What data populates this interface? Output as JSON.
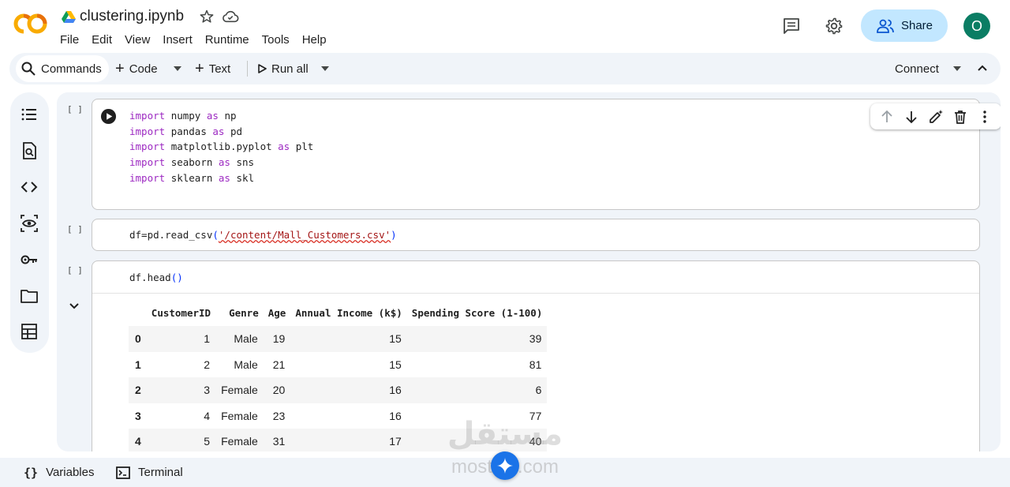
{
  "header": {
    "title": "clustering.ipynb",
    "menu": [
      "File",
      "Edit",
      "View",
      "Insert",
      "Runtime",
      "Tools",
      "Help"
    ],
    "share_label": "Share",
    "avatar_initial": "O"
  },
  "toolbar": {
    "commands_label": "Commands",
    "code_label": "Code",
    "text_label": "Text",
    "run_all_label": "Run all",
    "connect_label": "Connect"
  },
  "cells": [
    {
      "exec_count": "[ ]"
    },
    {
      "exec_count": "[ ]"
    },
    {
      "exec_count": "[ ]"
    }
  ],
  "cell1_code": [
    {
      "kw": "import",
      "mod": "numpy",
      "as": "as",
      "alias": "np"
    },
    {
      "kw": "import",
      "mod": "pandas",
      "as": "as",
      "alias": "pd"
    },
    {
      "kw": "import",
      "mod": "matplotlib.pyplot",
      "as": "as",
      "alias": "plt"
    },
    {
      "kw": "import",
      "mod": "seaborn",
      "as": "as",
      "alias": "sns"
    },
    {
      "kw": "import",
      "mod": "sklearn",
      "as": "as",
      "alias": "skl"
    }
  ],
  "cell2_code": {
    "prefix": "df=pd.read_csv",
    "open": "(",
    "string": "'/content/Mall_Customers.csv'",
    "close": ")"
  },
  "cell3_code": {
    "prefix": "df.head",
    "parens": "()"
  },
  "output_table": {
    "columns": [
      "",
      "CustomerID",
      "Genre",
      "Age",
      "Annual Income (k$)",
      "Spending Score (1-100)"
    ],
    "rows": [
      [
        "0",
        "1",
        "Male",
        "19",
        "15",
        "39"
      ],
      [
        "1",
        "2",
        "Male",
        "21",
        "15",
        "81"
      ],
      [
        "2",
        "3",
        "Female",
        "20",
        "16",
        "6"
      ],
      [
        "3",
        "4",
        "Female",
        "23",
        "16",
        "77"
      ],
      [
        "4",
        "5",
        "Female",
        "31",
        "17",
        "40"
      ]
    ]
  },
  "bottombar": {
    "variables_label": "Variables",
    "terminal_label": "Terminal"
  },
  "watermark": {
    "arabic": "مستقل",
    "latin": "mostaql.com"
  },
  "colors": {
    "accent": "#c2e7ff",
    "avatar": "#0b7d64",
    "keyword": "#9d2ac2",
    "string": "#a31515",
    "background_panel": "#f0f4f9"
  }
}
